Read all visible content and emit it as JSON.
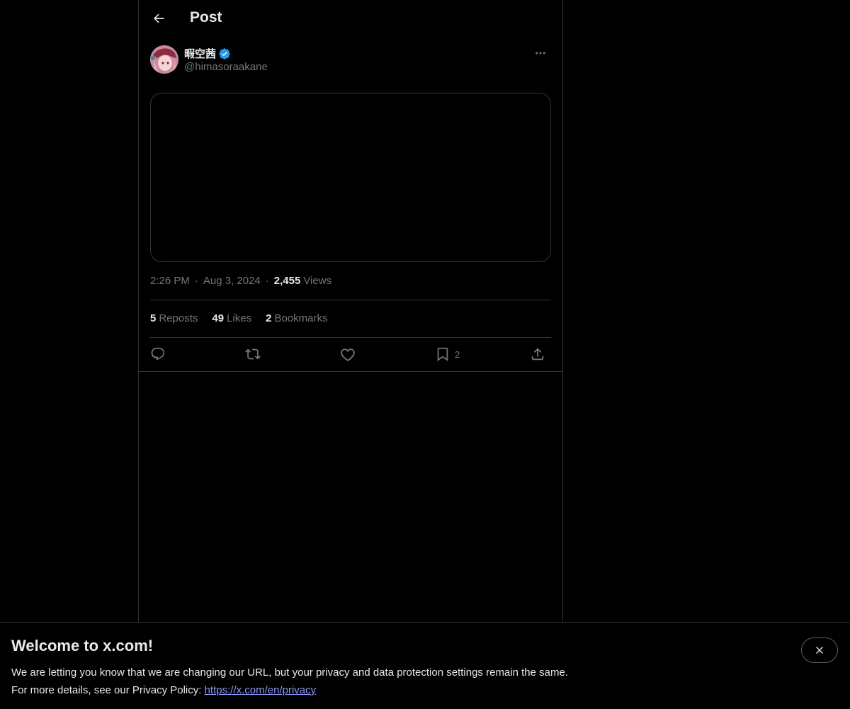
{
  "header": {
    "title": "Post"
  },
  "post": {
    "author": {
      "display_name": "暇空茜",
      "handle": "@himasoraakane",
      "verified": true
    },
    "meta": {
      "time": "2:26 PM",
      "date": "Aug 3, 2024",
      "views_count": "2,455",
      "views_label": "Views"
    },
    "stats": {
      "reposts_count": "5",
      "reposts_label": "Reposts",
      "likes_count": "49",
      "likes_label": "Likes",
      "bookmarks_count": "2",
      "bookmarks_label": "Bookmarks"
    },
    "actions": {
      "bookmark_count": "2"
    }
  },
  "banner": {
    "title": "Welcome to x.com!",
    "line1": "We are letting you know that we are changing our URL, but your privacy and data protection settings remain the same.",
    "line2_prefix": "For more details, see our Privacy Policy: ",
    "link": "https://x.com/en/privacy"
  },
  "colors": {
    "background": "#000000",
    "text_primary": "#e7e9ea",
    "text_secondary": "#71767b",
    "border": "#2f3336",
    "verified_blue": "#1d9bf0",
    "link": "#8b98f5"
  },
  "icons": {
    "back": "arrow-left-icon",
    "verified": "verified-badge-icon",
    "more": "more-horizontal-icon",
    "reply": "reply-icon",
    "repost": "repost-icon",
    "like": "heart-icon",
    "bookmark": "bookmark-icon",
    "share": "share-icon",
    "close": "close-icon"
  }
}
